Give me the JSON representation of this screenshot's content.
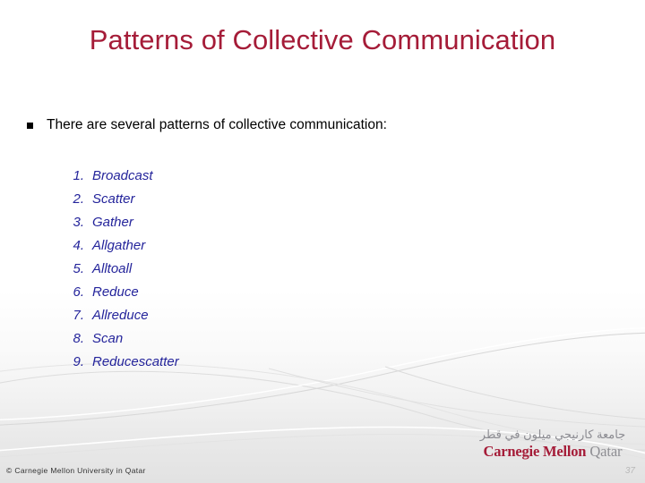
{
  "slide": {
    "title": "Patterns of Collective Communication",
    "intro_bullet": "There are several patterns of collective communication:",
    "bullet_glyph": "square-bullet",
    "items": [
      {
        "index": "1.",
        "label": "Broadcast"
      },
      {
        "index": "2.",
        "label": "Scatter"
      },
      {
        "index": "3.",
        "label": "Gather"
      },
      {
        "index": "4.",
        "label": "Allgather"
      },
      {
        "index": "5.",
        "label": "Alltoall"
      },
      {
        "index": "6.",
        "label": "Reduce"
      },
      {
        "index": "7.",
        "label": "Allreduce"
      },
      {
        "index": "8.",
        "label": "Scan"
      },
      {
        "index": "9.",
        "label": "Reducescatter"
      }
    ]
  },
  "logo": {
    "arabic": "جامعة كارنيجي ميلون في قطر",
    "name_primary": "Carnegie Mellon",
    "name_secondary": "Qatar"
  },
  "footer": {
    "copyright": "© Carnegie Mellon University in Qatar",
    "page_number": "37"
  },
  "colors": {
    "title": "#A51C38",
    "list_text": "#24249B",
    "body_text": "#000000",
    "logo_primary": "#A51C38",
    "logo_secondary": "#8E8E93",
    "page_number": "#B8B8B8"
  }
}
